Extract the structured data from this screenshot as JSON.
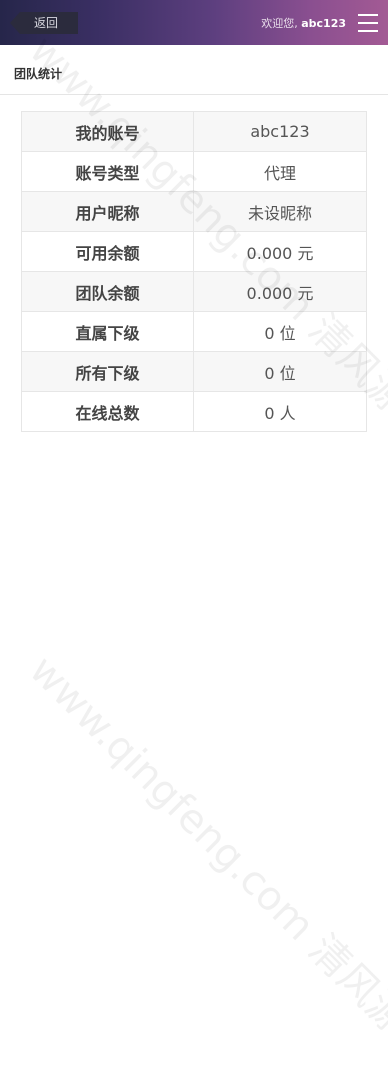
{
  "header": {
    "back_label": "返回",
    "welcome_prefix": "欢迎您,",
    "username": "abc123"
  },
  "section": {
    "title": "团队统计"
  },
  "stats": [
    {
      "label": "我的账号",
      "value": "abc123"
    },
    {
      "label": "账号类型",
      "value": "代理"
    },
    {
      "label": "用户昵称",
      "value": "未设昵称"
    },
    {
      "label": "可用余额",
      "value": "0.000 元"
    },
    {
      "label": "团队余额",
      "value": "0.000 元"
    },
    {
      "label": "直属下级",
      "value": "0 位"
    },
    {
      "label": "所有下级",
      "value": "0 位"
    },
    {
      "label": "在线总数",
      "value": "0 人"
    }
  ],
  "watermark": {
    "text": "www.qingfeng.com 清风源码"
  }
}
